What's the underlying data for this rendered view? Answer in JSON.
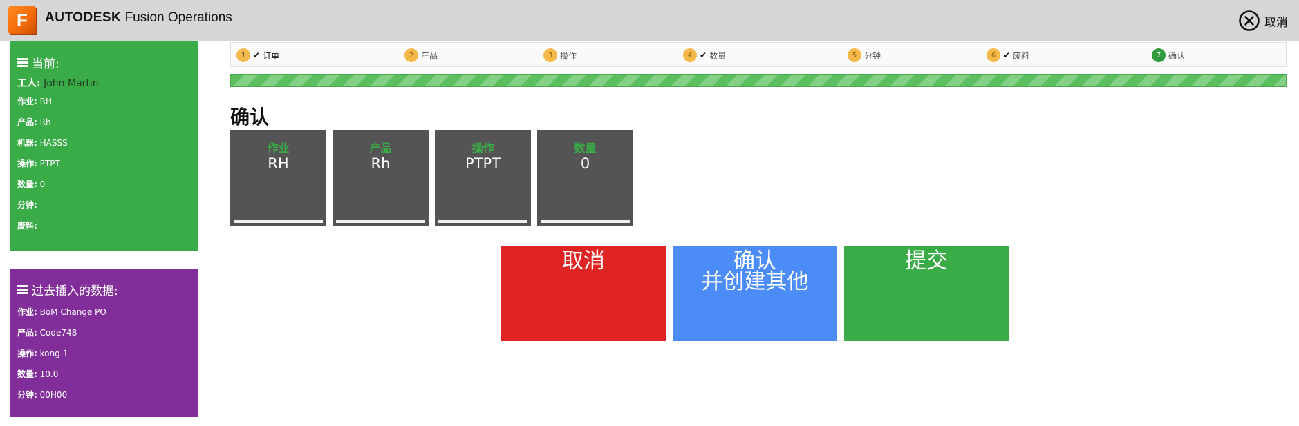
{
  "header": {
    "logo_letter": "F",
    "brand_strong": "AUTODESK",
    "brand_rest": "Fusion Operations",
    "cancel_label": "取消"
  },
  "sidebar": {
    "current": {
      "title": "当前:",
      "worker_label": "工人:",
      "worker_value": "John Martin",
      "rows": [
        {
          "label": "作业:",
          "value": "RH"
        },
        {
          "label": "产品:",
          "value": "Rh"
        },
        {
          "label": "机器:",
          "value": "HASSS"
        },
        {
          "label": "操作:",
          "value": "PTPT"
        },
        {
          "label": "数量:",
          "value": "0"
        },
        {
          "label": "分钟:",
          "value": ""
        },
        {
          "label": "废料:",
          "value": ""
        }
      ]
    },
    "past": {
      "title": "过去插入的数据:",
      "rows": [
        {
          "label": "作业:",
          "value": "BoM Change PO"
        },
        {
          "label": "产品:",
          "value": "Code748"
        },
        {
          "label": "操作:",
          "value": "kong-1"
        },
        {
          "label": "数量:",
          "value": "10.0"
        },
        {
          "label": "分钟:",
          "value": "00H00"
        }
      ]
    }
  },
  "steps": [
    {
      "num": "1",
      "label": "订单",
      "checked": true
    },
    {
      "num": "2",
      "label": "产品",
      "checked": false
    },
    {
      "num": "3",
      "label": "操作",
      "checked": false
    },
    {
      "num": "4",
      "label": "数量",
      "checked": true
    },
    {
      "num": "5",
      "label": "分钟",
      "checked": false
    },
    {
      "num": "6",
      "label": "废料",
      "checked": true
    },
    {
      "num": "7",
      "label": "确认",
      "checked": false
    }
  ],
  "progress_percent": 100,
  "page_title": "确认",
  "summary": [
    {
      "label": "作业",
      "value": "RH"
    },
    {
      "label": "产品",
      "value": "Rh"
    },
    {
      "label": "操作",
      "value": "PTPT"
    },
    {
      "label": "数量",
      "value": "0"
    }
  ],
  "actions": {
    "cancel": "取消",
    "confirm_line1": "确认",
    "confirm_line2": "并创建其他",
    "submit": "提交"
  },
  "colors": {
    "green": "#39ac47",
    "purple": "#812d9a",
    "red": "#e02424",
    "blue": "#4b8cf7",
    "card": "#545454",
    "step_badge": "#f5b94b"
  }
}
